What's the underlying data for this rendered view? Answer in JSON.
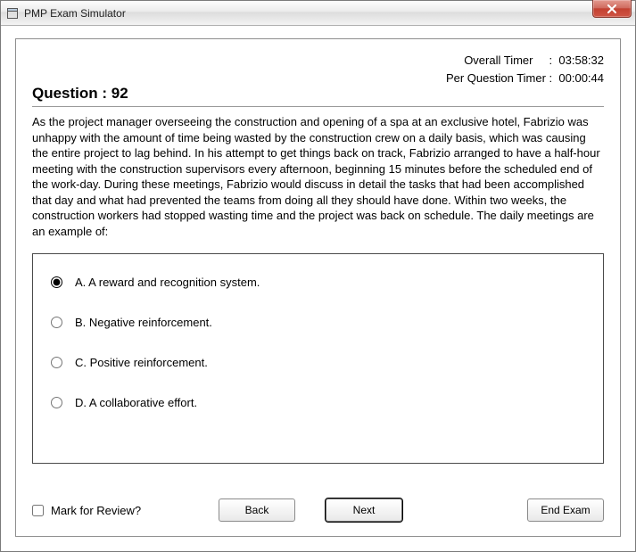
{
  "titlebar": {
    "title": "PMP Exam Simulator"
  },
  "timers": {
    "overall_label": "Overall Timer",
    "overall_value": "03:58:32",
    "perq_label": "Per Question Timer",
    "perq_value": "00:00:44"
  },
  "question": {
    "header_prefix": "Question : ",
    "number": "92",
    "text": "As the project manager overseeing the construction and opening of a spa at an exclusive hotel, Fabrizio was unhappy with the amount of time being wasted by the construction crew on a daily basis, which was causing the entire project to lag behind. In his attempt to get things back on track, Fabrizio arranged to have a half-hour meeting with the construction supervisors every afternoon, beginning 15 minutes before the scheduled end of the work-day. During these meetings, Fabrizio would discuss in detail the tasks that had been accomplished that day and what had prevented the teams from doing all they should have done. Within two weeks, the construction workers had stopped wasting time and the project was back on schedule. The daily meetings are an example of:"
  },
  "options": {
    "a": "A. A reward and recognition system.",
    "b": "B. Negative reinforcement.",
    "c": "C. Positive reinforcement.",
    "d": "D. A collaborative effort.",
    "selected": "a"
  },
  "footer": {
    "mark_label": "Mark for Review?",
    "back": "Back",
    "next": "Next",
    "end": "End Exam"
  }
}
